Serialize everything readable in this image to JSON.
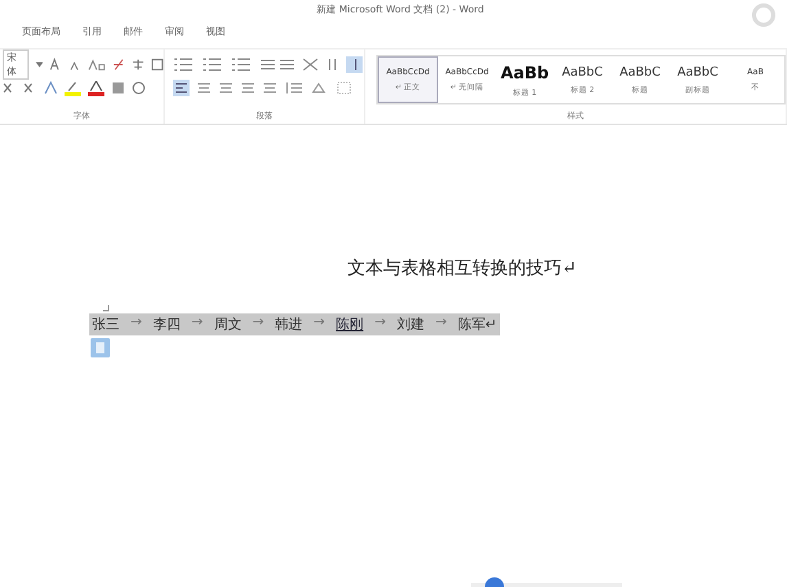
{
  "window": {
    "title": "新建 Microsoft Word 文档 (2) - Word"
  },
  "tabs": [
    {
      "label": "页面布局",
      "selected": false
    },
    {
      "label": "引用",
      "selected": false
    },
    {
      "label": "邮件",
      "selected": false
    },
    {
      "label": "审阅",
      "selected": false
    },
    {
      "label": "视图",
      "selected": false
    }
  ],
  "font_group": {
    "font_name": "宋体",
    "label": "字体"
  },
  "paragraph_group": {
    "label": "段落"
  },
  "styles_group": {
    "label": "样式",
    "styles": [
      {
        "sample": "AaBbCcDd",
        "name": "↵ 正文",
        "kind": "small",
        "selected": true
      },
      {
        "sample": "AaBbCcDd",
        "name": "↵ 无间隔",
        "kind": "small",
        "selected": false
      },
      {
        "sample": "AaBb",
        "name": "标题 1",
        "kind": "heavy",
        "selected": false
      },
      {
        "sample": "AaBbC",
        "name": "标题 2",
        "kind": "medium",
        "selected": false
      },
      {
        "sample": "AaBbC",
        "name": "标题",
        "kind": "medium",
        "selected": false
      },
      {
        "sample": "AaBbC",
        "name": "副标题",
        "kind": "medium",
        "selected": false
      },
      {
        "sample": "AaB",
        "name": "不",
        "kind": "small",
        "selected": false
      }
    ]
  },
  "document": {
    "heading": "文本与表格相互转换的技巧↵",
    "selected": true,
    "names": [
      {
        "text": "张三",
        "underlined": false
      },
      {
        "text": "李四",
        "underlined": false
      },
      {
        "text": "周文",
        "underlined": false
      },
      {
        "text": "韩进",
        "underlined": false
      },
      {
        "text": "陈刚",
        "underlined": true
      },
      {
        "text": "刘建",
        "underlined": false
      },
      {
        "text": "陈军↵",
        "underlined": false
      }
    ],
    "separator": "→"
  }
}
